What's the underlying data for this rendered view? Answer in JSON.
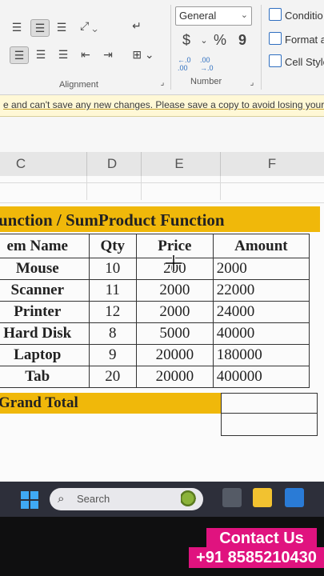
{
  "ribbon": {
    "alignment_label": "Alignment",
    "number_label": "Number",
    "number_format": "General",
    "currency_symbol": "$",
    "percent_symbol": "%",
    "comma_symbol": "9",
    "inc_decimal": "←.0 .00",
    "dec_decimal": ".00 →.0",
    "conditional": "Conditio",
    "format_as": "Format a",
    "cell_styles": "Cell Style"
  },
  "message_bar": {
    "text": "e and can't save any new changes. Please save a copy to avoid losing your"
  },
  "columns": [
    "C",
    "D",
    "E",
    "F"
  ],
  "sheet": {
    "title": "unction / SumProduct Function",
    "headers": {
      "name": "em Name",
      "qty": "Qty",
      "price": "Price",
      "amount": "Amount"
    },
    "rows": [
      {
        "name": "Mouse",
        "qty": "10",
        "price": "200",
        "amount": "2000"
      },
      {
        "name": "Scanner",
        "qty": "11",
        "price": "2000",
        "amount": "22000"
      },
      {
        "name": "Printer",
        "qty": "12",
        "price": "2000",
        "amount": "24000"
      },
      {
        "name": "Hard Disk",
        "qty": "8",
        "price": "5000",
        "amount": "40000"
      },
      {
        "name": "Laptop",
        "qty": "9",
        "price": "20000",
        "amount": "180000"
      },
      {
        "name": "Tab",
        "qty": "20",
        "price": "20000",
        "amount": "400000"
      }
    ],
    "grand_total": "Grand Total"
  },
  "taskbar": {
    "search_placeholder": "Search"
  },
  "overlay": {
    "contact": "Contact Us",
    "phone": "+91 8585210430"
  },
  "colors": {
    "band": "#f0b80a",
    "contact_bg": "#e0137f",
    "taskbar": "#2d2f3a"
  }
}
